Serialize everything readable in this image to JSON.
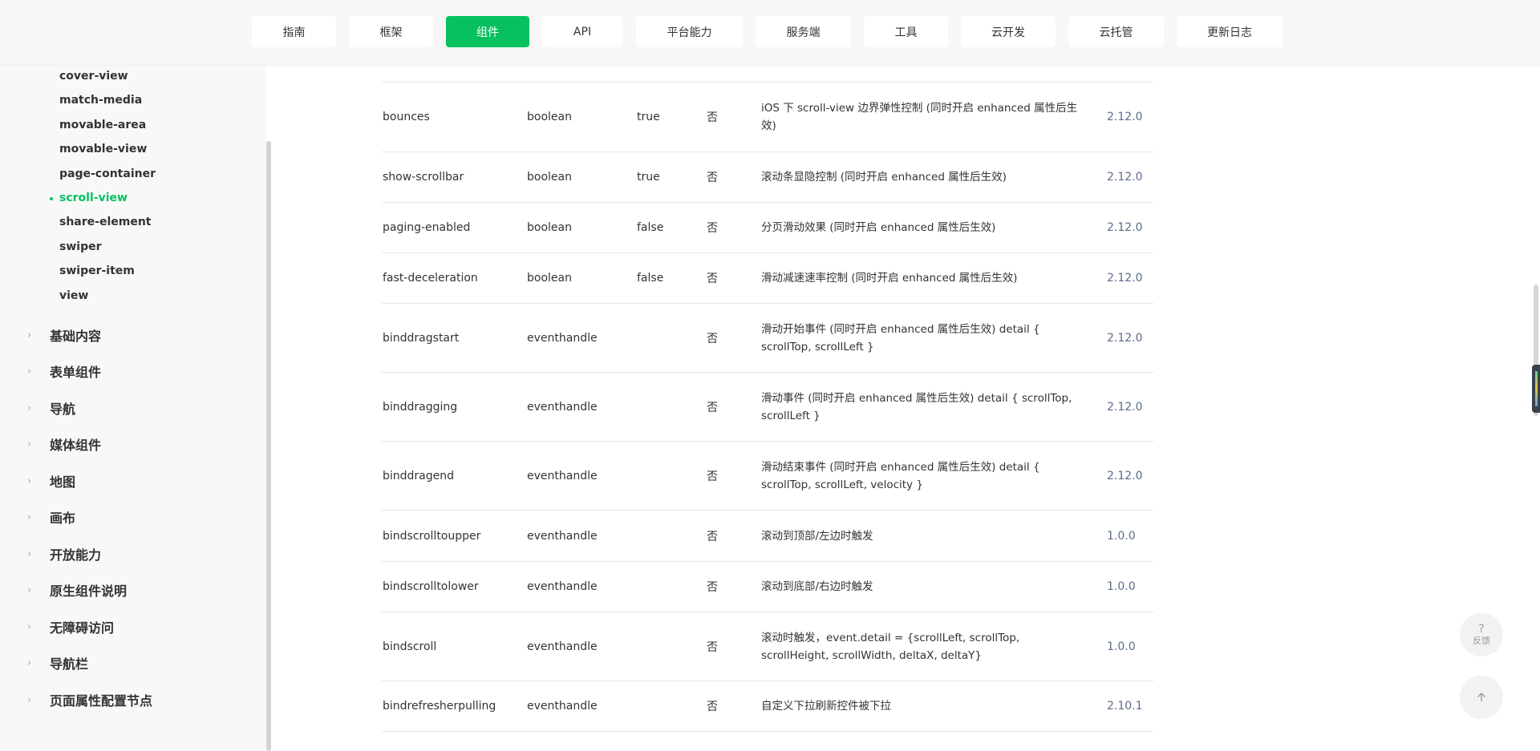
{
  "topnav": {
    "items": [
      {
        "label": "指南"
      },
      {
        "label": "框架"
      },
      {
        "label": "组件"
      },
      {
        "label": "API"
      },
      {
        "label": "平台能力"
      },
      {
        "label": "服务端"
      },
      {
        "label": "工具"
      },
      {
        "label": "云开发"
      },
      {
        "label": "云托管"
      },
      {
        "label": "更新日志"
      }
    ],
    "active": "组件"
  },
  "sidebar": {
    "sub_items": [
      {
        "label": "cover-view"
      },
      {
        "label": "match-media"
      },
      {
        "label": "movable-area"
      },
      {
        "label": "movable-view"
      },
      {
        "label": "page-container"
      },
      {
        "label": "scroll-view"
      },
      {
        "label": "share-element"
      },
      {
        "label": "swiper"
      },
      {
        "label": "swiper-item"
      },
      {
        "label": "view"
      }
    ],
    "active_sub_item": "scroll-view",
    "categories": [
      {
        "label": "基础内容"
      },
      {
        "label": "表单组件"
      },
      {
        "label": "导航"
      },
      {
        "label": "媒体组件"
      },
      {
        "label": "地图"
      },
      {
        "label": "画布"
      },
      {
        "label": "开放能力"
      },
      {
        "label": "原生组件说明"
      },
      {
        "label": "无障碍访问"
      },
      {
        "label": "导航栏"
      },
      {
        "label": "页面属性配置节点"
      }
    ]
  },
  "table": {
    "rows": [
      {
        "name": "bounces",
        "type": "boolean",
        "default": "true",
        "required": "否",
        "desc": "iOS 下 scroll-view 边界弹性控制 (同时开启 enhanced 属性后生效)",
        "version": "2.12.0"
      },
      {
        "name": "show-scrollbar",
        "type": "boolean",
        "default": "true",
        "required": "否",
        "desc": "滚动条显隐控制 (同时开启 enhanced 属性后生效)",
        "version": "2.12.0"
      },
      {
        "name": "paging-enabled",
        "type": "boolean",
        "default": "false",
        "required": "否",
        "desc": "分页滑动效果 (同时开启 enhanced 属性后生效)",
        "version": "2.12.0"
      },
      {
        "name": "fast-deceleration",
        "type": "boolean",
        "default": "false",
        "required": "否",
        "desc": "滑动减速速率控制 (同时开启 enhanced 属性后生效)",
        "version": "2.12.0"
      },
      {
        "name": "binddragstart",
        "type": "eventhandle",
        "default": "",
        "required": "否",
        "desc": "滑动开始事件 (同时开启 enhanced 属性后生效) detail { scrollTop, scrollLeft }",
        "version": "2.12.0"
      },
      {
        "name": "binddragging",
        "type": "eventhandle",
        "default": "",
        "required": "否",
        "desc": "滑动事件 (同时开启 enhanced 属性后生效) detail { scrollTop, scrollLeft }",
        "version": "2.12.0"
      },
      {
        "name": "binddragend",
        "type": "eventhandle",
        "default": "",
        "required": "否",
        "desc": "滑动结束事件 (同时开启 enhanced 属性后生效) detail { scrollTop, scrollLeft, velocity }",
        "version": "2.12.0"
      },
      {
        "name": "bindscrolltoupper",
        "type": "eventhandle",
        "default": "",
        "required": "否",
        "desc": "滚动到顶部/左边时触发",
        "version": "1.0.0"
      },
      {
        "name": "bindscrolltolower",
        "type": "eventhandle",
        "default": "",
        "required": "否",
        "desc": "滚动到底部/右边时触发",
        "version": "1.0.0"
      },
      {
        "name": "bindscroll",
        "type": "eventhandle",
        "default": "",
        "required": "否",
        "desc": "滚动时触发，event.detail = {scrollLeft, scrollTop, scrollHeight, scrollWidth, deltaX, deltaY}",
        "version": "1.0.0"
      },
      {
        "name": "bindrefresherpulling",
        "type": "eventhandle",
        "default": "",
        "required": "否",
        "desc": "自定义下拉刷新控件被下拉",
        "version": "2.10.1"
      }
    ]
  },
  "floating": {
    "feedback_symbol": "?",
    "feedback_label": "反馈",
    "back_to_top_icon": "arrow-up-icon",
    "feedback_icon": "question-icon"
  },
  "colors": {
    "accent": "#07c160",
    "version_text": "#5b6b8c"
  }
}
